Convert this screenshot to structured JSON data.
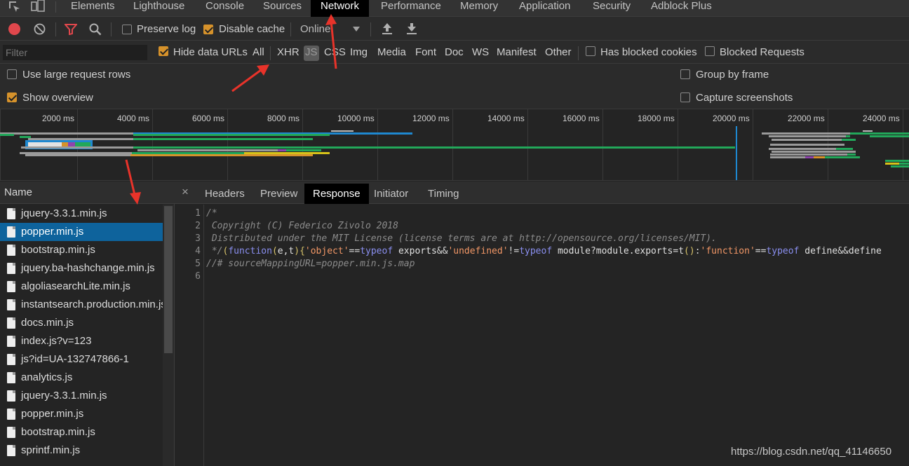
{
  "tabs": [
    {
      "label": "Elements"
    },
    {
      "label": "Lighthouse"
    },
    {
      "label": "Console"
    },
    {
      "label": "Sources"
    },
    {
      "label": "Network",
      "active": true
    },
    {
      "label": "Performance"
    },
    {
      "label": "Memory"
    },
    {
      "label": "Application"
    },
    {
      "label": "Security"
    },
    {
      "label": "Adblock Plus"
    }
  ],
  "toolbar": {
    "preserve_log": "Preserve log",
    "preserve_log_checked": false,
    "disable_cache": "Disable cache",
    "disable_cache_checked": true,
    "throttle": "Online"
  },
  "filter": {
    "placeholder": "Filter",
    "hide_data_urls": "Hide data URLs",
    "hide_data_urls_checked": true,
    "types": [
      "All",
      "XHR",
      "JS",
      "CSS",
      "Img",
      "Media",
      "Font",
      "Doc",
      "WS",
      "Manifest",
      "Other"
    ],
    "selected_type": "JS",
    "has_blocked_cookies": "Has blocked cookies",
    "blocked_requests": "Blocked Requests"
  },
  "settings": {
    "large_rows": "Use large request rows",
    "large_rows_checked": false,
    "show_overview": "Show overview",
    "show_overview_checked": true,
    "group_by_frame": "Group by frame",
    "group_by_frame_checked": false,
    "capture_screenshots": "Capture screenshots",
    "capture_screenshots_checked": false
  },
  "overview": {
    "ticks": [
      "2000 ms",
      "4000 ms",
      "6000 ms",
      "8000 ms",
      "10000 ms",
      "12000 ms",
      "14000 ms",
      "16000 ms",
      "18000 ms",
      "20000 ms",
      "22000 ms",
      "24000 ms"
    ]
  },
  "name_pane": {
    "header": "Name",
    "files": [
      {
        "name": "jquery-3.3.1.min.js"
      },
      {
        "name": "popper.min.js",
        "selected": true
      },
      {
        "name": "bootstrap.min.js"
      },
      {
        "name": "jquery.ba-hashchange.min.js"
      },
      {
        "name": "algoliasearchLite.min.js"
      },
      {
        "name": "instantsearch.production.min.js"
      },
      {
        "name": "docs.min.js"
      },
      {
        "name": "index.js?v=123"
      },
      {
        "name": "js?id=UA-132747866-1"
      },
      {
        "name": "analytics.js"
      },
      {
        "name": "jquery-3.3.1.min.js"
      },
      {
        "name": "popper.min.js"
      },
      {
        "name": "bootstrap.min.js"
      },
      {
        "name": "sprintf.min.js"
      }
    ]
  },
  "detail": {
    "close": "×",
    "tabs": [
      {
        "label": "Headers"
      },
      {
        "label": "Preview"
      },
      {
        "label": "Response",
        "active": true
      },
      {
        "label": "Initiator"
      },
      {
        "label": "Timing"
      }
    ],
    "line_numbers": [
      "1",
      "2",
      "3",
      "4",
      "5",
      "6"
    ],
    "code": {
      "l1": "/*",
      "l2": " Copyright (C) Federico Zivolo 2018",
      "l3": " Distributed under the MIT License (license terms are at http://opensource.org/licenses/MIT).",
      "l4_comment": " */",
      "l4_code": "(function(e,t){'object'==typeof exports&&'undefined'!=typeof module?module.exports=t():'function'==typeof define&&define",
      "l5": "//# sourceMappingURL=popper.min.js.map"
    }
  },
  "watermark": "https://blog.csdn.net/qq_41146650",
  "colors": {
    "accent_orange": "#d6922b",
    "record_red": "#e0474c",
    "selected_row": "#0e639c",
    "bar_green": "#22a85a",
    "bar_blue": "#1e88d0",
    "annotation_red": "#e8332a"
  }
}
